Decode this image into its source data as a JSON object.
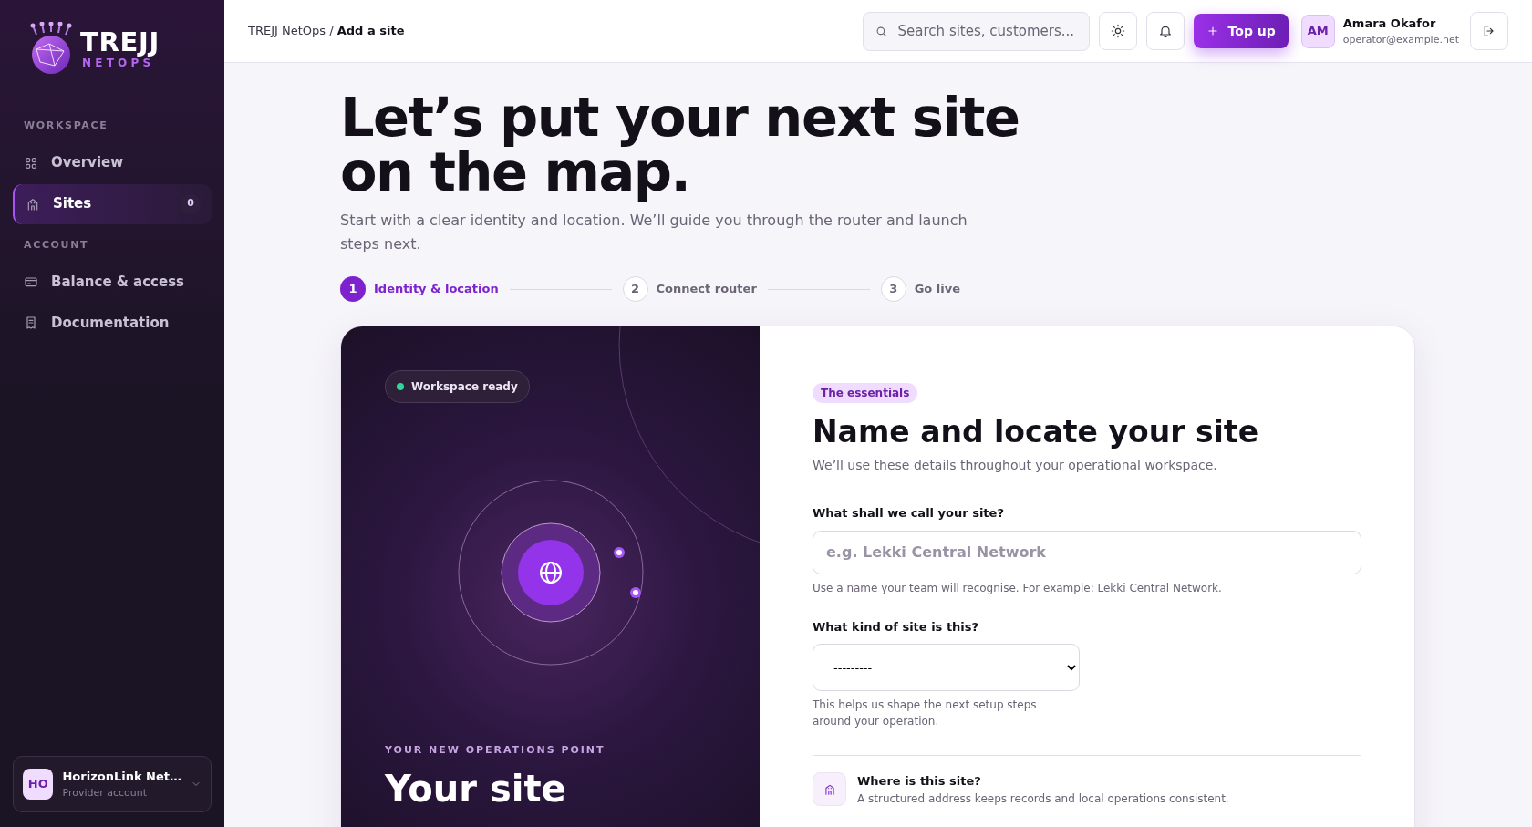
{
  "brand": {
    "name": "TREJJ",
    "tagline": "NETOPS"
  },
  "sidebar": {
    "sections": [
      {
        "title": "WORKSPACE",
        "items": [
          {
            "label": "Overview",
            "selected": false
          },
          {
            "label": "Sites",
            "selected": true,
            "badge": "0"
          }
        ]
      },
      {
        "title": "ACCOUNT",
        "items": [
          {
            "label": "Balance & access",
            "selected": false
          },
          {
            "label": "Documentation",
            "selected": false
          }
        ]
      }
    ],
    "account": {
      "initials": "HO",
      "name": "HorizonLink Net…",
      "role": "Provider account"
    }
  },
  "header": {
    "breadcrumb": [
      "TREJJ NetOps",
      "Add a site"
    ],
    "breadcrumb_separator": "/",
    "search": {
      "placeholder": "Search sites, customers..."
    },
    "top_up": "Top up",
    "user": {
      "initials": "AM",
      "name": "Amara Okafor",
      "email": "operator@example.net"
    }
  },
  "page": {
    "title": "Let’s put your next site on the map.",
    "subtitle": "Start with a clear identity and location. We’ll guide you through the router and launch steps next."
  },
  "steps": [
    {
      "number": "1",
      "label": "Identity & location",
      "selected": true
    },
    {
      "number": "2",
      "label": "Connect router",
      "selected": false
    },
    {
      "number": "3",
      "label": "Go live",
      "selected": false
    }
  ],
  "hero": {
    "status": "Workspace ready",
    "eyebrow": "YOUR NEW OPERATIONS POINT",
    "title": "Your site"
  },
  "form": {
    "badge": "The essentials",
    "title": "Name and locate your site",
    "subtitle": "We’ll use these details throughout your operational workspace.",
    "fields": [
      {
        "kind": "text",
        "label": "What shall we call your site?",
        "placeholder": "e.g. Lekki Central Network",
        "help": "Use a name your team will recognise. For example: Lekki Central Network."
      },
      {
        "kind": "select",
        "label": "What kind of site is this?",
        "value": "---------",
        "help": "This helps us shape the next setup steps around your operation."
      }
    ],
    "section": {
      "title": "Where is this site?",
      "text": "A structured address keeps records and local operations consistent."
    }
  }
}
